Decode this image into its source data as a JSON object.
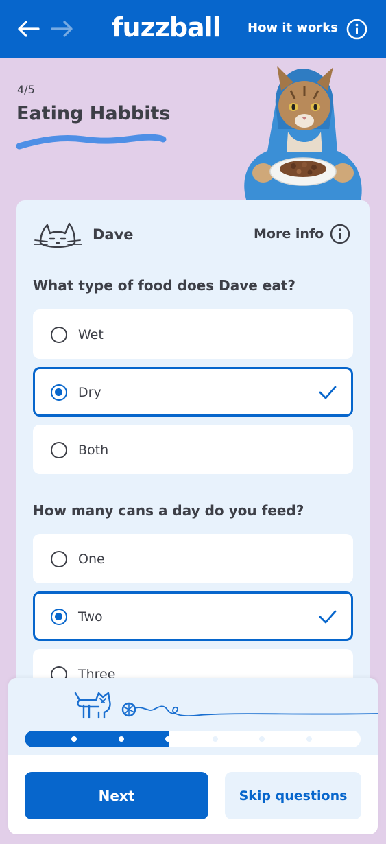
{
  "header": {
    "logo": "fuzzball",
    "how_it_works": "How it works",
    "back_icon": "arrow-left-icon",
    "forward_icon": "arrow-right-icon",
    "info_icon": "info-icon"
  },
  "step": {
    "count": "4/5",
    "title": "Eating Habbits"
  },
  "pet": {
    "name": "Dave",
    "more_info": "More info"
  },
  "questions": [
    {
      "text": "What type of food does Dave eat?",
      "options": [
        {
          "label": "Wet",
          "selected": false
        },
        {
          "label": "Dry",
          "selected": true
        },
        {
          "label": "Both",
          "selected": false
        }
      ]
    },
    {
      "text": "How many cans a day do you feed?",
      "options": [
        {
          "label": "One",
          "selected": false
        },
        {
          "label": "Two",
          "selected": true
        },
        {
          "label": "Three",
          "selected": false
        }
      ]
    }
  ],
  "progress": {
    "fraction": 0.43,
    "dots_total": 6,
    "dots_done": 3
  },
  "actions": {
    "next": "Next",
    "skip": "Skip questions"
  },
  "colors": {
    "brand_blue": "#0766cc",
    "background_lilac": "#e2cfe9",
    "card_blue": "#e8f2fc"
  }
}
